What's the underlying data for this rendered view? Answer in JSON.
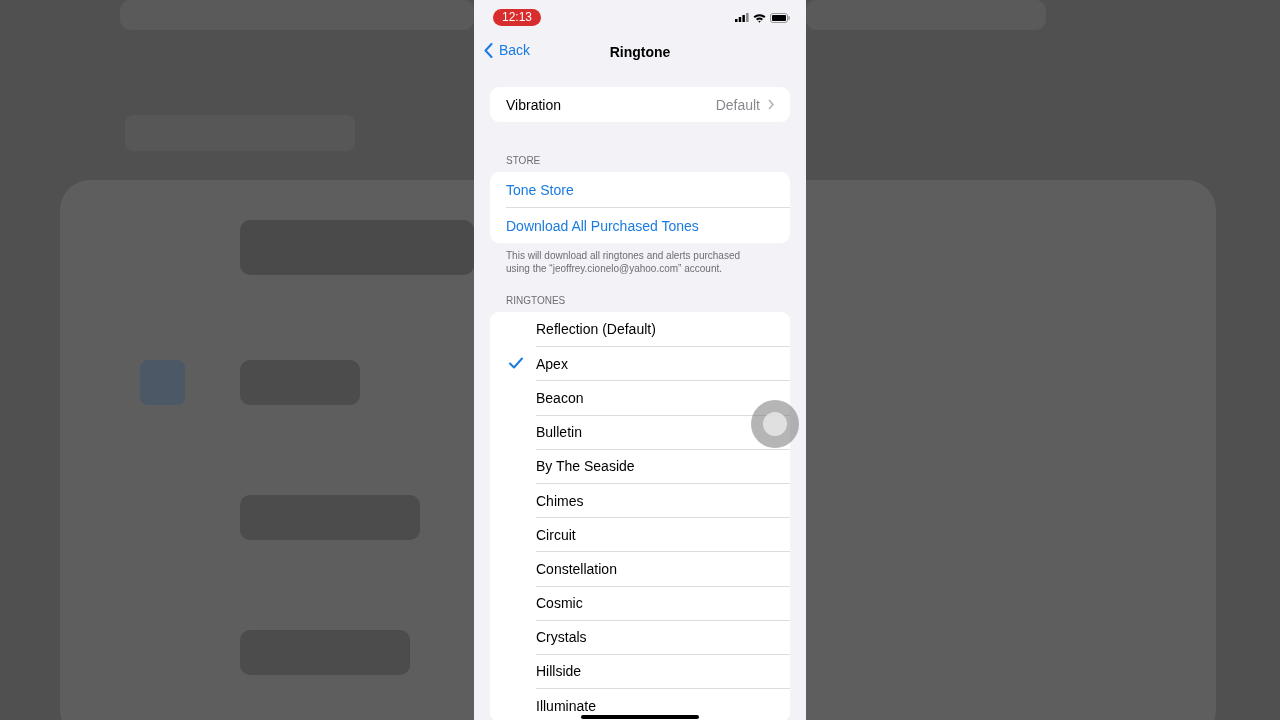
{
  "status_bar": {
    "time": "12:13"
  },
  "nav": {
    "back": "Back",
    "title": "Ringtone"
  },
  "vibration": {
    "label": "Vibration",
    "value": "Default"
  },
  "store": {
    "header": "STORE",
    "items": [
      "Tone Store",
      "Download All Purchased Tones"
    ],
    "footer": "This will download all ringtones and alerts purchased using the “jeoffrey.cionelo@yahoo.com” account."
  },
  "ringtones": {
    "header": "RINGTONES",
    "items": [
      {
        "label": "Reflection (Default)",
        "selected": false
      },
      {
        "label": "Apex",
        "selected": true
      },
      {
        "label": "Beacon",
        "selected": false
      },
      {
        "label": "Bulletin",
        "selected": false
      },
      {
        "label": "By The Seaside",
        "selected": false
      },
      {
        "label": "Chimes",
        "selected": false
      },
      {
        "label": "Circuit",
        "selected": false
      },
      {
        "label": "Constellation",
        "selected": false
      },
      {
        "label": "Cosmic",
        "selected": false
      },
      {
        "label": "Crystals",
        "selected": false
      },
      {
        "label": "Hillside",
        "selected": false
      },
      {
        "label": "Illuminate",
        "selected": false
      }
    ]
  }
}
